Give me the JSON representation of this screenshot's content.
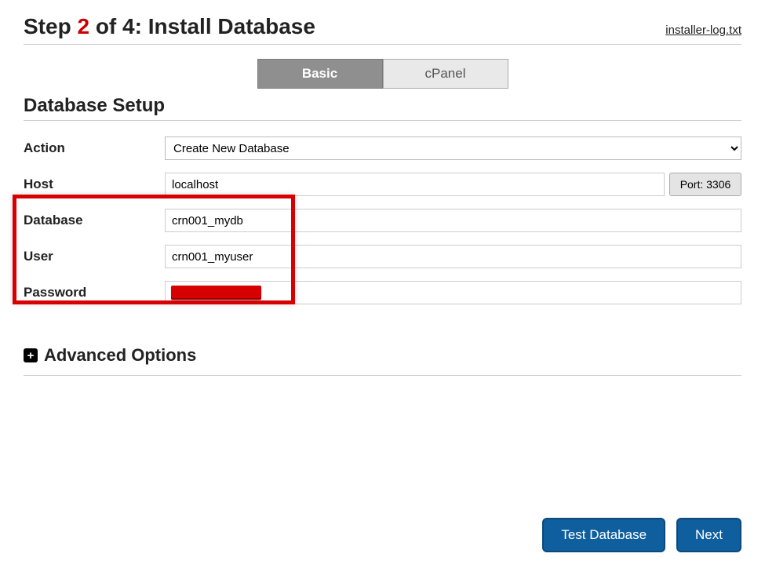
{
  "header": {
    "step_prefix": "Step ",
    "step_current": "2",
    "step_suffix": " of 4: Install Database",
    "log_link": "installer-log.txt"
  },
  "tabs": {
    "basic": "Basic",
    "cpanel": "cPanel"
  },
  "section": {
    "title": "Database Setup"
  },
  "form": {
    "action_label": "Action",
    "action_value": "Create New Database",
    "host_label": "Host",
    "host_value": "localhost",
    "port_label": "Port: 3306",
    "database_label": "Database",
    "database_value": "crn001_mydb",
    "user_label": "User",
    "user_value": "crn001_myuser",
    "password_label": "Password"
  },
  "advanced": {
    "label": "Advanced Options"
  },
  "buttons": {
    "test": "Test Database",
    "next": "Next"
  }
}
